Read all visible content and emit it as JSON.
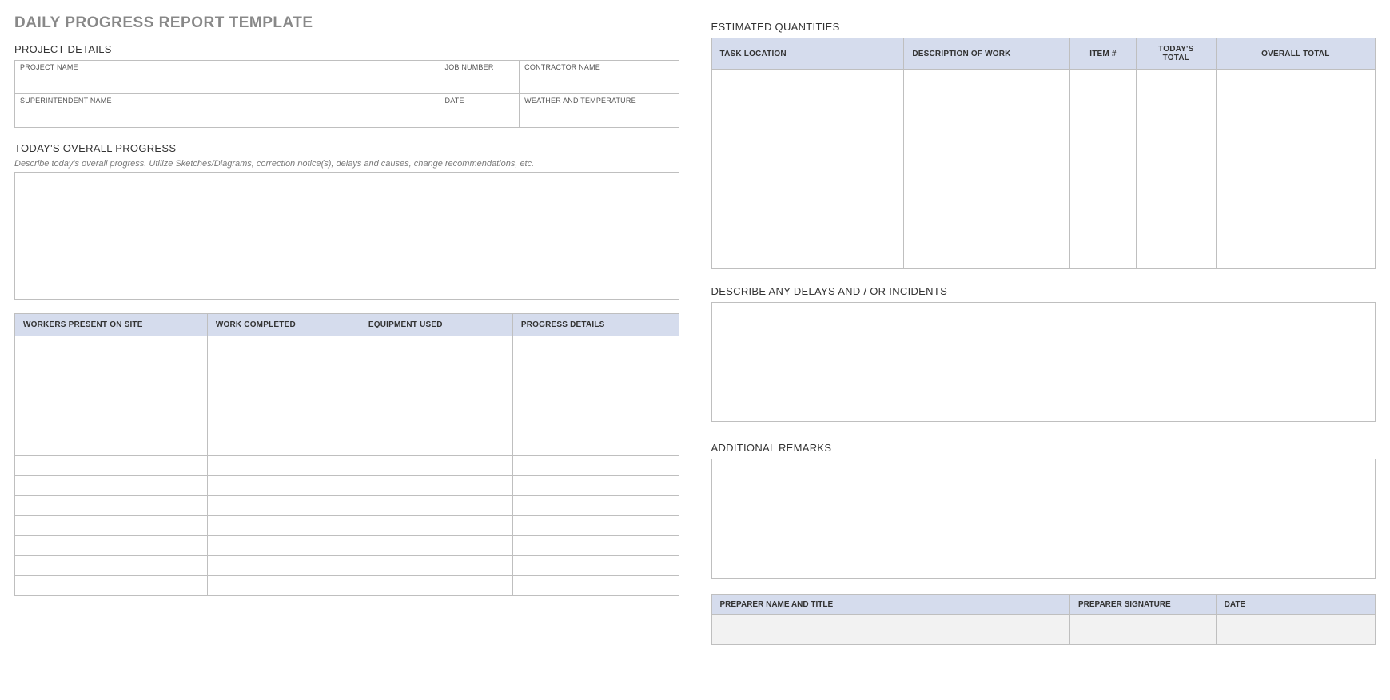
{
  "title": "DAILY PROGRESS REPORT TEMPLATE",
  "sections": {
    "project_details": "PROJECT DETAILS",
    "todays_progress": "TODAY'S OVERALL PROGRESS",
    "estimated_quantities": "ESTIMATED QUANTITIES",
    "delays": "DESCRIBE ANY DELAYS AND / OR INCIDENTS",
    "remarks": "ADDITIONAL REMARKS"
  },
  "hints": {
    "progress": "Describe today's overall progress.  Utilize Sketches/Diagrams, correction notice(s), delays and causes, change recommendations, etc."
  },
  "project_details": {
    "labels": {
      "project_name": "PROJECT NAME",
      "job_number": "JOB NUMBER",
      "contractor_name": "CONTRACTOR NAME",
      "superintendent_name": "SUPERINTENDENT NAME",
      "date": "DATE",
      "weather": "WEATHER AND TEMPERATURE"
    },
    "values": {
      "project_name": "",
      "job_number": "",
      "contractor_name": "",
      "superintendent_name": "",
      "date": "",
      "weather": ""
    }
  },
  "progress_table": {
    "headers": {
      "workers": "WORKERS PRESENT ON SITE",
      "work": "WORK COMPLETED",
      "equipment": "EQUIPMENT USED",
      "details": "PROGRESS DETAILS"
    }
  },
  "quantities_table": {
    "headers": {
      "location": "TASK LOCATION",
      "description": "DESCRIPTION OF WORK",
      "item": "ITEM #",
      "today": "TODAY'S TOTAL",
      "overall": "OVERALL TOTAL"
    }
  },
  "signoff": {
    "headers": {
      "preparer": "PREPARER NAME AND TITLE",
      "signature": "PREPARER SIGNATURE",
      "date": "DATE"
    },
    "values": {
      "preparer": "",
      "signature": "",
      "date": ""
    }
  },
  "big_values": {
    "overall_progress": "",
    "delays": "",
    "remarks": ""
  }
}
